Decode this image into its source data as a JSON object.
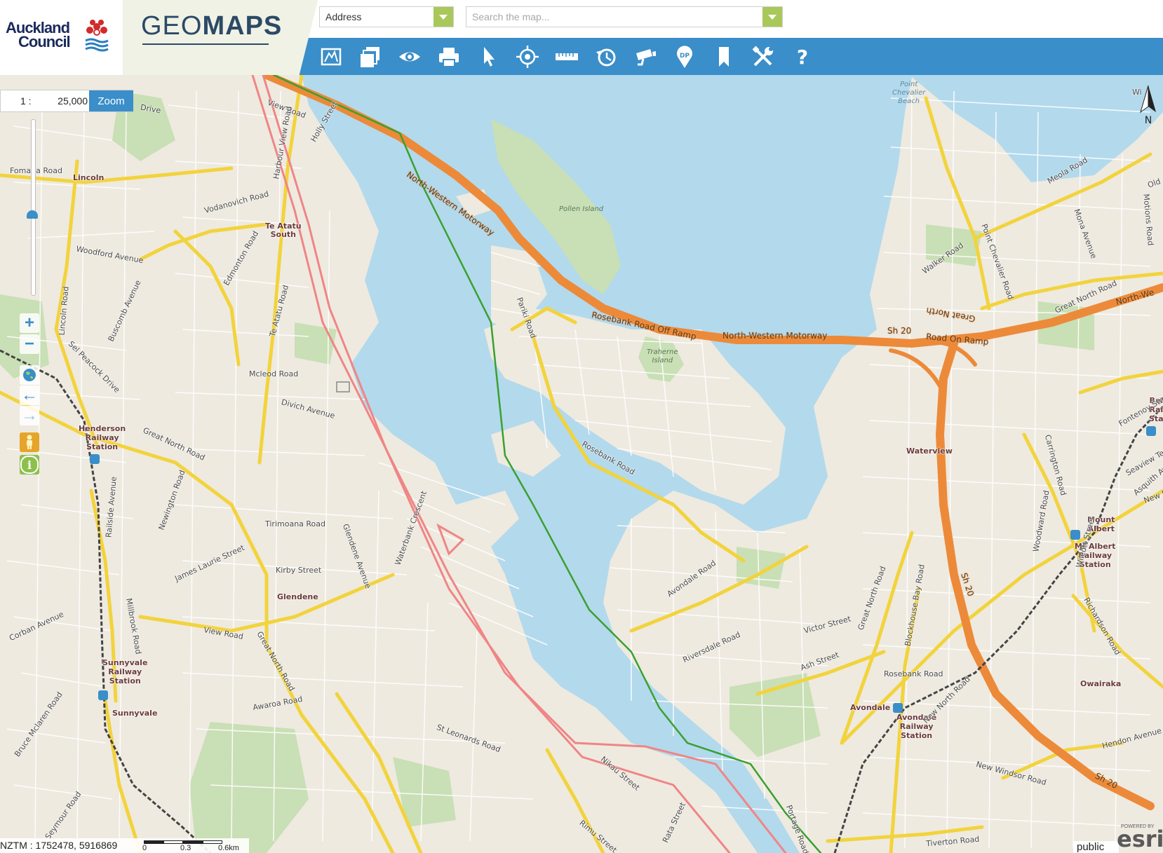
{
  "header": {
    "logo_line1": "Auckland",
    "logo_line2": "Council",
    "app_title_light": "GEO",
    "app_title_bold": "MAPS",
    "search_type": "Address",
    "search_placeholder": "Search the map..."
  },
  "toolbar": {
    "tools": [
      "basemaps-icon",
      "layers-icon",
      "eye-icon",
      "print-icon",
      "select-pointer-icon",
      "locate-target-icon",
      "measure-ruler-icon",
      "history-clock-icon",
      "camera-icon",
      "dp-marker-icon",
      "bookmark-icon",
      "tools-wrench-icon",
      "help-question-icon"
    ],
    "help_glyph": "?",
    "dp_glyph": "DP"
  },
  "map_controls": {
    "scale_prefix": "1 :",
    "scale_value": "25,000",
    "zoom_label": "Zoom",
    "zoom_in_glyph": "+",
    "zoom_out_glyph": "−",
    "back_glyph": "←",
    "forward_glyph": "→",
    "info_glyph": "i",
    "coord_label": "NZTM : 1752478, 5916869",
    "scalebar_labels": [
      "0",
      "0.3",
      "0.6km"
    ],
    "north_label": "N",
    "public_label": "public",
    "esri_label": "esri",
    "esri_powered": "POWERED BY"
  },
  "colors": {
    "toolbar": "#3a8ec9",
    "water": "#b3d9ec",
    "land": "#eeeae0",
    "park": "#c9dfb5",
    "road_major": "#f2d33c",
    "motorway": "#ec8a3a",
    "route_red": "#f08585",
    "route_green": "#3aa030",
    "rail": "#444444"
  },
  "labels": {
    "places": {
      "lincoln": "Lincoln",
      "te_atatu_south": [
        "Te Atatu",
        "South"
      ],
      "henderson_station": [
        "Henderson",
        "Railway",
        "Station"
      ],
      "glendene": "Glendene",
      "sunnyvale_station": [
        "Sunnyvale",
        "Railway",
        "Station"
      ],
      "sunnyvale": "Sunnyvale",
      "waterview": "Waterview",
      "mount_albert": [
        "Mount",
        "Albert"
      ],
      "mt_albert_station": [
        "Mt Albert",
        "Railway",
        "Station"
      ],
      "owairaka": "Owairaka",
      "avondale": "Avondale",
      "avondale_station": [
        "Avondale",
        "Railway",
        "Station"
      ],
      "bal_station": [
        "Bal",
        "Rai",
        "Sta"
      ]
    },
    "water": {
      "pollen_island": "Pollen Island",
      "traherne_island": [
        "Traherne",
        "Island"
      ],
      "point_chevalier_beach": [
        "Point",
        "Chevalier",
        "Beach"
      ]
    },
    "motorways": {
      "nw_motorway_a": "North-Western Motorway",
      "nw_motorway_b": "North-Western Motorway",
      "nw_motorway_c": "North-We",
      "rosebank_off": "Rosebank Road Off Ramp",
      "gn_on_ramp": "Road On Ramp",
      "gn_on_ramp_top": "Great North",
      "sh20_a": "Sh 20",
      "sh20_b": "Sh 20",
      "sh20_c": "Sh 20"
    },
    "roads": {
      "view_road_top": "View Road",
      "tui_drive": "Drive",
      "fomana": "Fomana Road",
      "vodanovich": "Vodanovich Road",
      "edmonton": "Edmonton Road",
      "woodford": "Woodford Avenue",
      "lincoln_road": "Lincoln Road",
      "buscomb": "Buscomb Avenue",
      "sel_peacock": "Sel Peacock Drive",
      "te_atatu_road": "Te Atatu Road",
      "mcleod": "Mcleod Road",
      "divich": "Divich Avenue",
      "great_north_a": "Great North Road",
      "great_north_b": "Great North Road",
      "railside": "Railside Avenue",
      "newington": "Newington Road",
      "tirimoana": "Tirimoana Road",
      "james_laurie": "James Laurie Street",
      "kirby": "Kirby Street",
      "glendene_ave": "Glendene Avenue",
      "view_road": "View Road",
      "corban": "Corban Avenue",
      "millbrook": "Millbrook Road",
      "bruce_mclaren": "Bruce Mclaren Road",
      "seymour": "Seymour Road",
      "awaroa": "Awaroa Road",
      "parriki": "Pariki Road",
      "rosebank_road": "Rosebank Road",
      "meola": "Meola Road",
      "walker": "Walker Road",
      "point_chevalier": "Point Chevalier Road",
      "great_north_c": "Great North Road",
      "carrington": "Carrington Road",
      "woodward": "Woodward Road",
      "richardson": "Richardson Road",
      "new_north": "New North Road",
      "ash_street": "Ash Street",
      "blockhouse": "Blockhouse Bay Road",
      "great_north_d": "Great North Road",
      "avondale_road": "Avondale Road",
      "riversdale": "Riversdale Road",
      "victor": "Victor Street",
      "tiverton": "Tiverton Road",
      "st_leonards": "St Leonards Road",
      "portage": "Portage Road",
      "rata": "Rata Street",
      "rimu": "Rimu Street",
      "nikau": "Nikau Street",
      "new_windsor": "New Windsor Road",
      "rosebank_rd_s": "Rosebank Road",
      "hendon": "Hendon Avenue",
      "fontenoy": "Fontenoy Street",
      "seaview": "Seaview Terrace",
      "wilcott": "Wilcott Street",
      "asquith": "Asquith Ave",
      "holly": "Holly Street",
      "harbour_view": "Harbour View Road",
      "mona": "Mona Avenue",
      "motions": "Motions Road",
      "waterbank": "Waterbank Crescent",
      "new_north_b": "New N",
      "old": "Old",
      "wi": "Wi"
    }
  }
}
